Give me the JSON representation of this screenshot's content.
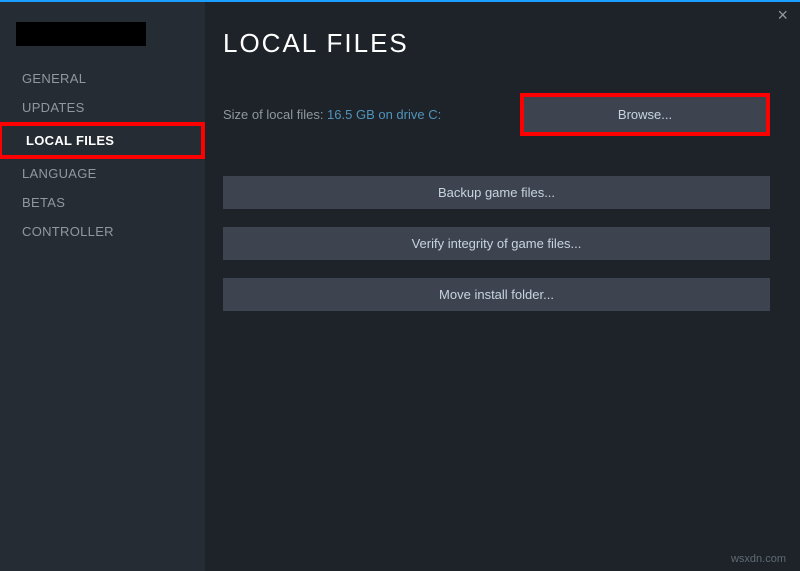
{
  "titlebar": {
    "close_symbol": "×"
  },
  "sidebar": {
    "items": [
      {
        "label": "GENERAL"
      },
      {
        "label": "UPDATES"
      },
      {
        "label": "LOCAL FILES"
      },
      {
        "label": "LANGUAGE"
      },
      {
        "label": "BETAS"
      },
      {
        "label": "CONTROLLER"
      }
    ]
  },
  "main": {
    "title": "LOCAL FILES",
    "size_label": "Size of local files: ",
    "size_value": "16.5 GB on drive C:",
    "browse_label": "Browse...",
    "backup_label": "Backup game files...",
    "verify_label": "Verify integrity of game files...",
    "move_label": "Move install folder..."
  },
  "watermark": "wsxdn.com"
}
